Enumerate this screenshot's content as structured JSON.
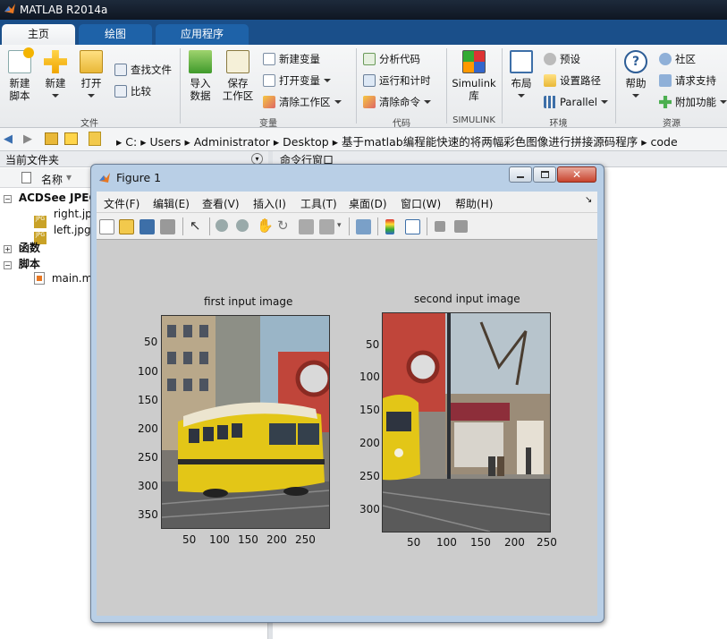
{
  "app": {
    "title": "MATLAB R2014a"
  },
  "tabs": [
    "主页",
    "绘图",
    "应用程序"
  ],
  "ribbon": {
    "file_group": {
      "label": "文件",
      "new_script": "新建\n脚本",
      "new": "新建",
      "open": "打开",
      "find_files": "查找文件",
      "compare": "比较"
    },
    "variable_group": {
      "label": "变量",
      "import": "导入\n数据",
      "save_ws": "保存\n工作区",
      "new_var": "新建变量",
      "open_var": "打开变量",
      "clear_ws": "清除工作区"
    },
    "code_group": {
      "label": "代码",
      "analyze": "分析代码",
      "run_time": "运行和计时",
      "clear_cmd": "清除命令"
    },
    "simulink_group": {
      "label": "SIMULINK",
      "simulink": "Simulink\n库"
    },
    "env_group": {
      "label": "环境",
      "layout": "布局",
      "prefs": "预设",
      "set_path": "设置路径",
      "parallel": "Parallel"
    },
    "res_group": {
      "label": "资源",
      "help": "帮助",
      "community": "社区",
      "request": "请求支持",
      "addons": "附加功能"
    }
  },
  "address": {
    "segments": [
      "C:",
      "Users",
      "Administrator",
      "Desktop",
      "基于matlab编程能快速的将两幅彩色图像进行拼接源码程序",
      "code"
    ]
  },
  "left_panel": {
    "title": "当前文件夹",
    "column": "名称",
    "groups": [
      {
        "name": "ACDSee JPEG",
        "items": [
          "right.jpg",
          "left.jpg"
        ]
      },
      {
        "name": "函数",
        "items": []
      },
      {
        "name": "脚本",
        "items": [
          "main.m"
        ]
      }
    ]
  },
  "right_panel": {
    "title": "命令行窗口"
  },
  "figure": {
    "title": "Figure 1",
    "menus": [
      "文件(F)",
      "编辑(E)",
      "查看(V)",
      "插入(I)",
      "工具(T)",
      "桌面(D)",
      "窗口(W)",
      "帮助(H)"
    ],
    "axes1": {
      "title": "first input image",
      "yticks": [
        "50",
        "100",
        "150",
        "200",
        "250",
        "300",
        "350"
      ],
      "xticks": [
        "50",
        "100",
        "150",
        "200",
        "250"
      ]
    },
    "axes2": {
      "title": "second input image",
      "yticks": [
        "50",
        "100",
        "150",
        "200",
        "250",
        "300"
      ],
      "xticks": [
        "50",
        "100",
        "150",
        "200",
        "250"
      ]
    }
  },
  "colors": {
    "matlab_blue": "#1a4f8a",
    "tram_yellow": "#e6c80f",
    "figure_bg": "#cccccc"
  }
}
